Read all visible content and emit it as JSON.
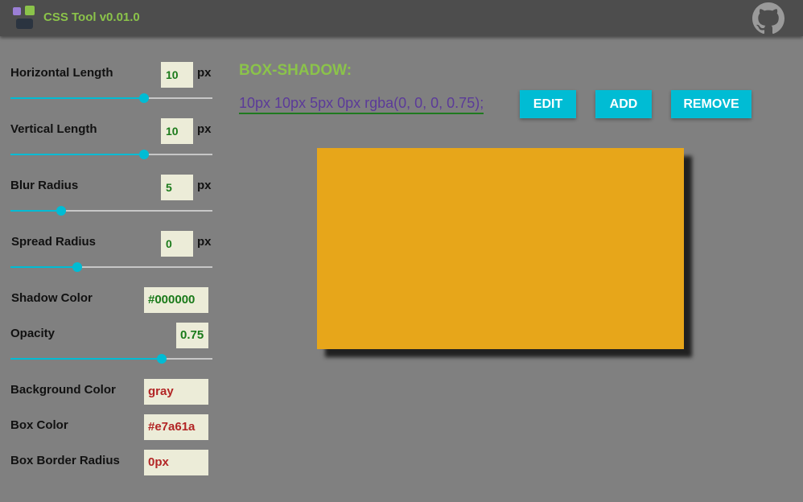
{
  "app": {
    "title": "CSS Tool v0.01.0",
    "logo_icon": "css-tool-logo-icon",
    "github_icon": "github-icon"
  },
  "colors": {
    "accent_green": "#8bc34a",
    "button": "#00bcd4",
    "box": "#e7a61a",
    "background": "#808080"
  },
  "controls": {
    "horizontal_length": {
      "label": "Horizontal Length",
      "value": "10",
      "unit": "px",
      "slider_fraction": 0.66
    },
    "vertical_length": {
      "label": "Vertical Length",
      "value": "10",
      "unit": "px",
      "slider_fraction": 0.66
    },
    "blur_radius": {
      "label": "Blur Radius",
      "value": "5",
      "unit": "px",
      "slider_fraction": 0.25
    },
    "spread_radius": {
      "label": "Spread Radius",
      "value": "0",
      "unit": "px",
      "slider_fraction": 0.33
    },
    "shadow_color": {
      "label": "Shadow Color",
      "value": "#000000"
    },
    "opacity": {
      "label": "Opacity",
      "value": "0.75",
      "slider_fraction": 0.75
    },
    "background_color": {
      "label": "Background Color",
      "value": "gray"
    },
    "box_color": {
      "label": "Box Color",
      "value": "#e7a61a"
    },
    "box_border_radius": {
      "label": "Box Border Radius",
      "value": "0px"
    }
  },
  "main": {
    "section_title": "BOX-SHADOW:",
    "css_output": "10px 10px 5px 0px rgba(0, 0, 0, 0.75);",
    "buttons": {
      "edit": "EDIT",
      "add": "ADD",
      "remove": "REMOVE"
    }
  }
}
